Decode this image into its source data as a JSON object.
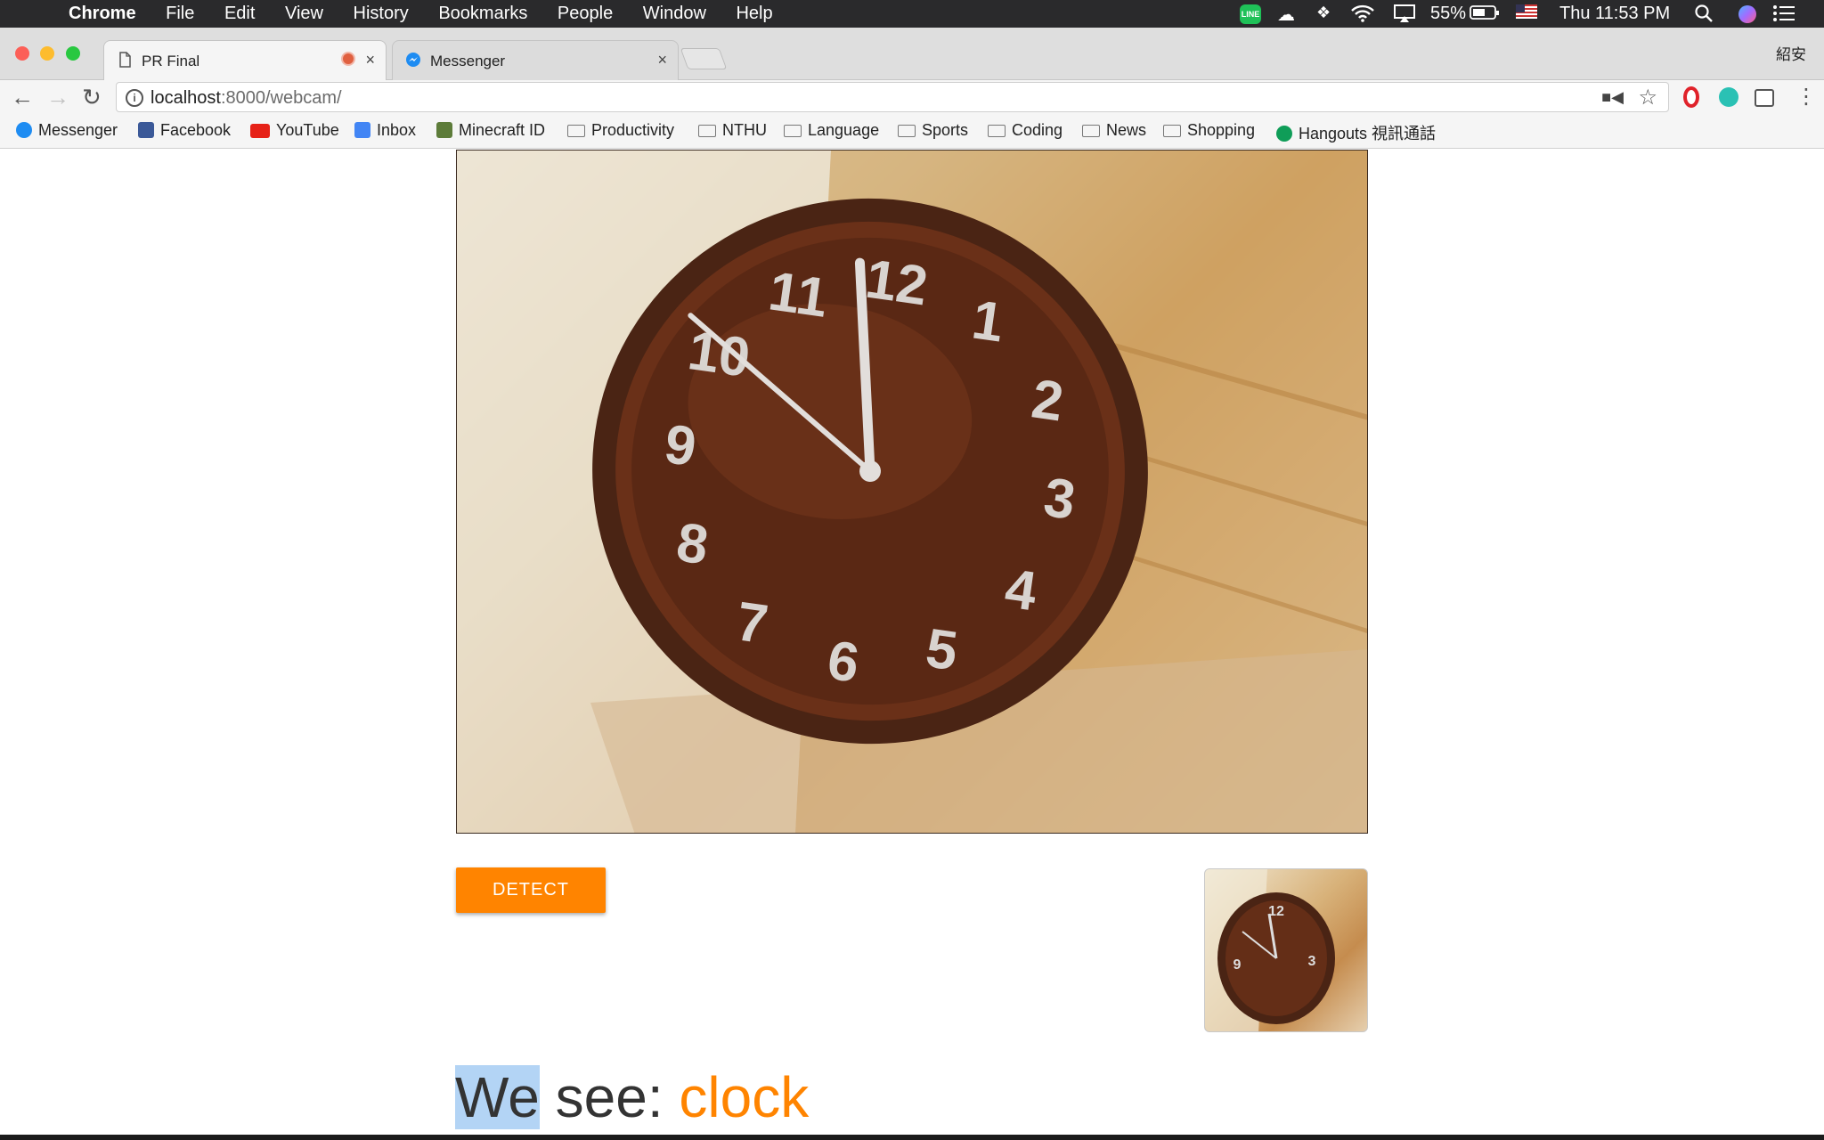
{
  "menubar": {
    "app_name": "Chrome",
    "items": [
      "File",
      "Edit",
      "View",
      "History",
      "Bookmarks",
      "People",
      "Window",
      "Help"
    ],
    "line_label": "LINE",
    "battery": "55%",
    "clock": "Thu 11:53 PM"
  },
  "tabs": [
    {
      "label": "PR Final",
      "active": true,
      "recording": true
    },
    {
      "label": "Messenger",
      "active": false
    }
  ],
  "profile_name": "紹安",
  "address_bar": {
    "host": "localhost",
    "rest": ":8000/webcam/"
  },
  "bookmarks": [
    {
      "label": "Messenger",
      "icon": "messenger-icon"
    },
    {
      "label": "Facebook",
      "icon": "facebook-icon"
    },
    {
      "label": "YouTube",
      "icon": "youtube-icon"
    },
    {
      "label": "Inbox",
      "icon": "inbox-icon"
    },
    {
      "label": "Minecraft ID",
      "icon": "minecraft-icon"
    },
    {
      "label": "Productivity",
      "icon": "folder-icon"
    },
    {
      "label": "NTHU",
      "icon": "folder-icon"
    },
    {
      "label": "Language",
      "icon": "folder-icon"
    },
    {
      "label": "Sports",
      "icon": "folder-icon"
    },
    {
      "label": "Coding",
      "icon": "folder-icon"
    },
    {
      "label": "News",
      "icon": "folder-icon"
    },
    {
      "label": "Shopping",
      "icon": "folder-icon"
    },
    {
      "label": "Hangouts 視訊通話",
      "icon": "hangouts-icon"
    }
  ],
  "page": {
    "detect_button": "DETECT",
    "result_prefix_highlight": "We",
    "result_prefix_rest": " see: ",
    "result_object": "clock"
  },
  "clock_numerals": [
    "12",
    "1",
    "2",
    "3",
    "4",
    "5",
    "6",
    "7",
    "8",
    "9",
    "10",
    "11"
  ],
  "colors": {
    "accent": "#ff8400",
    "menubar": "#2a2a2c",
    "highlight": "#b3d4f5"
  }
}
